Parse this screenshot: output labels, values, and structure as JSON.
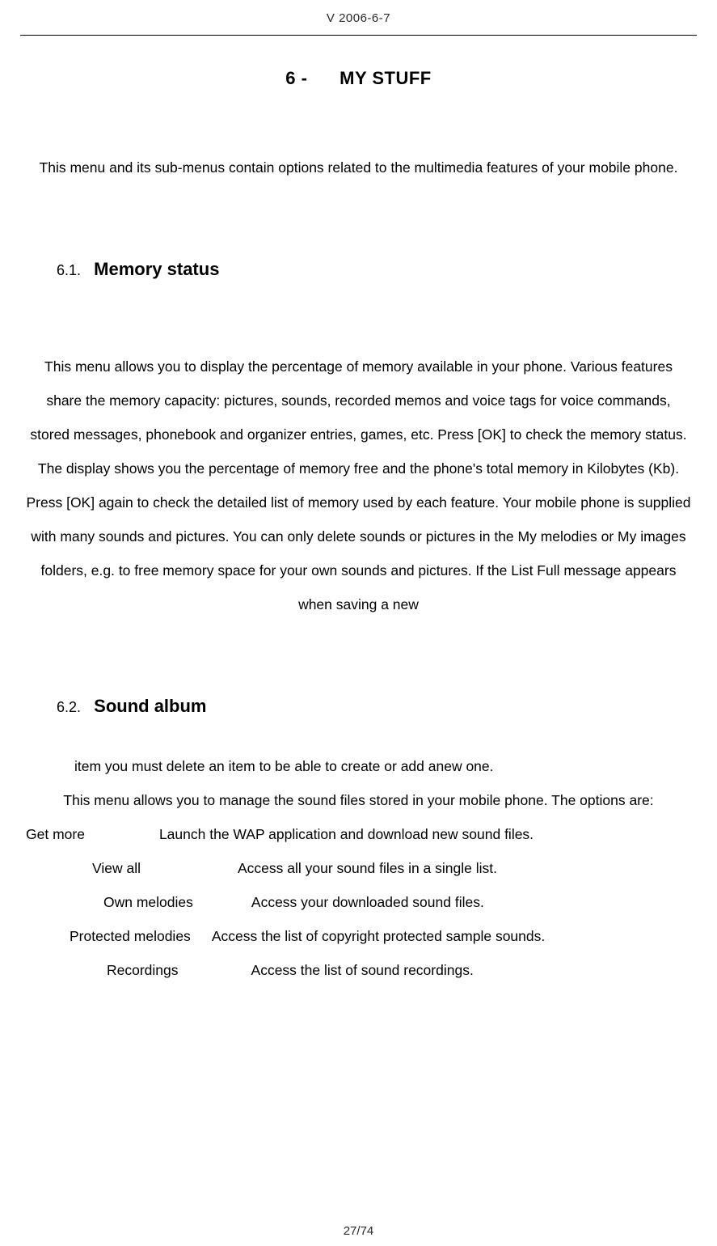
{
  "header": {
    "version": "V 2006-6-7"
  },
  "chapter": {
    "number_label": "6 -",
    "title": "MY STUFF"
  },
  "intro": "This menu and its sub-menus contain options related to the multimedia features of your mobile phone.",
  "section1": {
    "num": "6.1.",
    "title": "Memory status",
    "body": "This menu allows you to display the percentage of memory available in your phone. Various features share the memory capacity: pictures, sounds, recorded memos and voice tags for voice commands, stored messages, phonebook and organizer entries, games, etc. Press [OK] to check the memory status. The display shows you the percentage of memory free and the phone's total memory in Kilobytes (Kb). Press [OK] again to check the detailed list of memory used by each feature. Your mobile phone is supplied with many sounds and pictures. You can only delete sounds or pictures in the My melodies or My images folders, e.g. to free memory space for your own sounds and pictures. If the List Full message appears when saving a new"
  },
  "section2": {
    "num": "6.2.",
    "title": "Sound album",
    "continued": "item you must delete an item to be able to create or add anew one.",
    "intro": "This menu allows you to manage the sound files stored in your mobile phone. The options are:",
    "options": {
      "get_more": {
        "name": "Get more",
        "desc": "Launch the WAP application and download new sound files."
      },
      "view_all": {
        "name": "View all",
        "desc": "Access all your sound files in a single list."
      },
      "own_melodies": {
        "name": "Own melodies",
        "desc": "Access your downloaded sound files."
      },
      "protected_melodies": {
        "name": "Protected melodies",
        "desc": "Access the list of copyright protected sample sounds."
      },
      "recordings": {
        "name": "Recordings",
        "desc": "Access the list of sound recordings."
      }
    }
  },
  "page_number": "27/74"
}
